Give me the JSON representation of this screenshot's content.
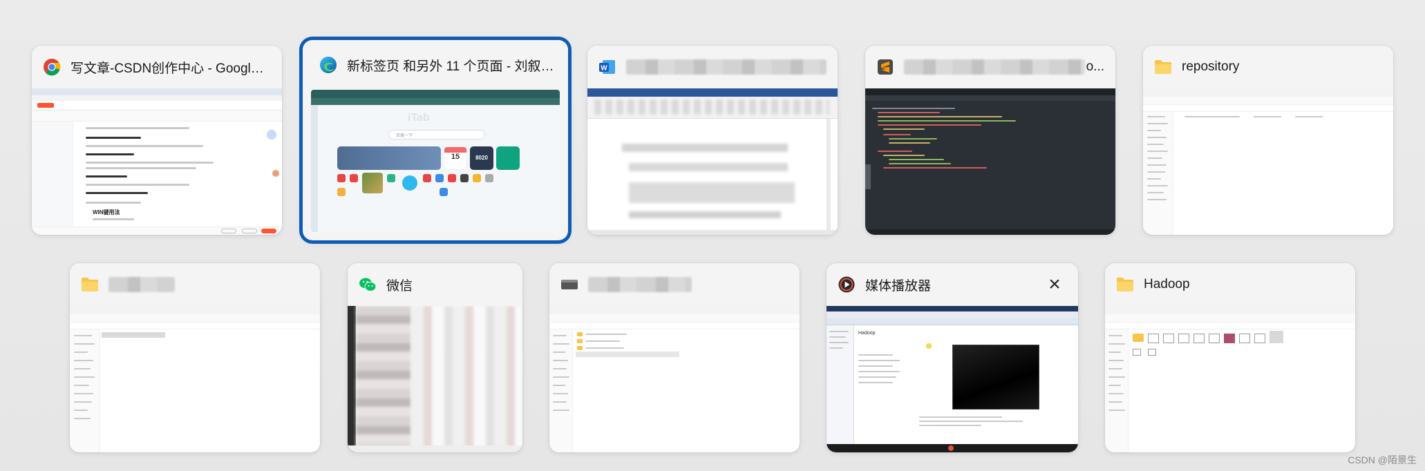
{
  "task_switcher": {
    "row1": [
      {
        "title": "写文章-CSDN创作中心 - Google C...",
        "icon": "chrome-icon"
      },
      {
        "title": "新标签页 和另外 11 个页面 - 刘叙 -...",
        "icon": "edge-icon",
        "selected": true
      },
      {
        "title": "",
        "icon": "word-icon"
      },
      {
        "title": "o...",
        "icon": "sublime-icon"
      },
      {
        "title": "repository",
        "icon": "folder-icon"
      }
    ],
    "row2": [
      {
        "title": "",
        "icon": "folder-icon"
      },
      {
        "title": "微信",
        "icon": "wechat-icon"
      },
      {
        "title": "",
        "icon": "terminal-icon"
      },
      {
        "title": "媒体播放器",
        "icon": "media-player-icon",
        "close": "×"
      },
      {
        "title": "Hadoop",
        "icon": "folder-icon"
      }
    ]
  },
  "thumbnails": {
    "csdn": {
      "heading": "WIN键用法",
      "publish_label": "发布文章",
      "note_1": "第三个王：Ctrl+R键盘大",
      "note_2": "第二个王：Ctrl+Z键盘",
      "note_3": "第二个王：Shift（即英键盘的大",
      "note_4": "第三个王：Alt+Tab（切换应用程序）"
    },
    "edge": {
      "logo": "iTab",
      "search_placeholder": "百度一下",
      "calendar_day": "15",
      "clock": "8020"
    },
    "media": {
      "folder": "Hadoop"
    }
  },
  "watermark": "CSDN @陌景生",
  "colors": {
    "selection": "#0f5bb5",
    "csdn_red": "#fc5531",
    "chrome_blue": "#1a73e8",
    "folder_yellow": "#f8c44a",
    "wechat_green": "#07c160"
  }
}
